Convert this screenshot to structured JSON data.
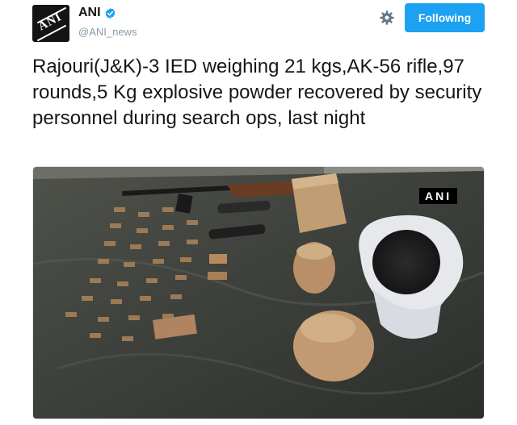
{
  "account": {
    "name": "ANI",
    "handle": "@ANI_news",
    "avatar_logo_text": "ANI",
    "verified_icon": "verified-badge-icon"
  },
  "header": {
    "settings_icon": "gear-icon",
    "follow_button_label": "Following"
  },
  "tweet": {
    "text": "Rajouri(J&K)-3 IED weighing 21 kgs,AK-56 rifle,97 rounds,5 Kg explosive powder recovered by security personnel during search ops, last night"
  },
  "media": {
    "watermark": "ANI"
  },
  "colors": {
    "accent": "#1da1f2",
    "text": "#14171a",
    "secondary_text": "#8899a6"
  }
}
